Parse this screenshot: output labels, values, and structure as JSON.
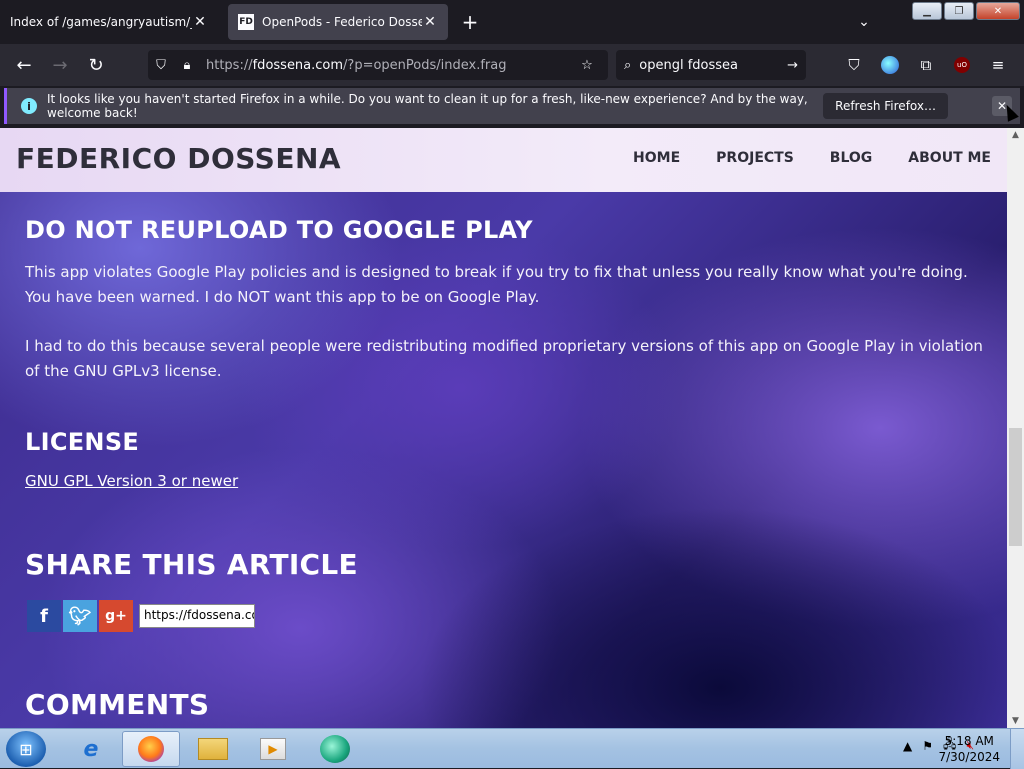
{
  "browser": {
    "tabs": [
      {
        "title": "Index of /games/angryautism/_vani",
        "active": false
      },
      {
        "title": "OpenPods - Federico Dossena",
        "active": true,
        "favicon": "FD"
      }
    ],
    "url_prefix": "https://",
    "url_host": "fdossena.com",
    "url_path": "/?p=openPods/index.frag",
    "search_query": "opengl fdossea",
    "ublock_label": "uO"
  },
  "notification": {
    "message": "It looks like you haven't started Firefox in a while. Do you want to clean it up for a fresh, like-new experience? And by the way, welcome back!",
    "button": "Refresh Firefox…"
  },
  "site": {
    "title": "FEDERICO DOSSENA",
    "nav": [
      "HOME",
      "PROJECTS",
      "BLOG",
      "ABOUT ME"
    ]
  },
  "article": {
    "h_reupload": "DO NOT REUPLOAD TO GOOGLE PLAY",
    "p1": "This app violates Google Play policies and is designed to break if you try to fix that unless you really know what you're doing. You have been warned. I do NOT want this app to be on Google Play.",
    "p2": "I had to do this because several people were redistributing modified proprietary versions of this app on Google Play in violation of the GNU GPLv3 license.",
    "h_license": "LICENSE",
    "license_link": "GNU GPL Version 3 or newer",
    "h_share": "SHARE THIS ARTICLE",
    "share_url": "https://fdossena.com/?p=openPods/index.frag",
    "h_comments": "COMMENTS"
  },
  "taskbar": {
    "time": "5:18 AM",
    "date": "7/30/2024"
  },
  "colors": {
    "accent": "#9059ff",
    "browser_bg": "#1c1b22",
    "header_bg": "#e7d8f3"
  }
}
